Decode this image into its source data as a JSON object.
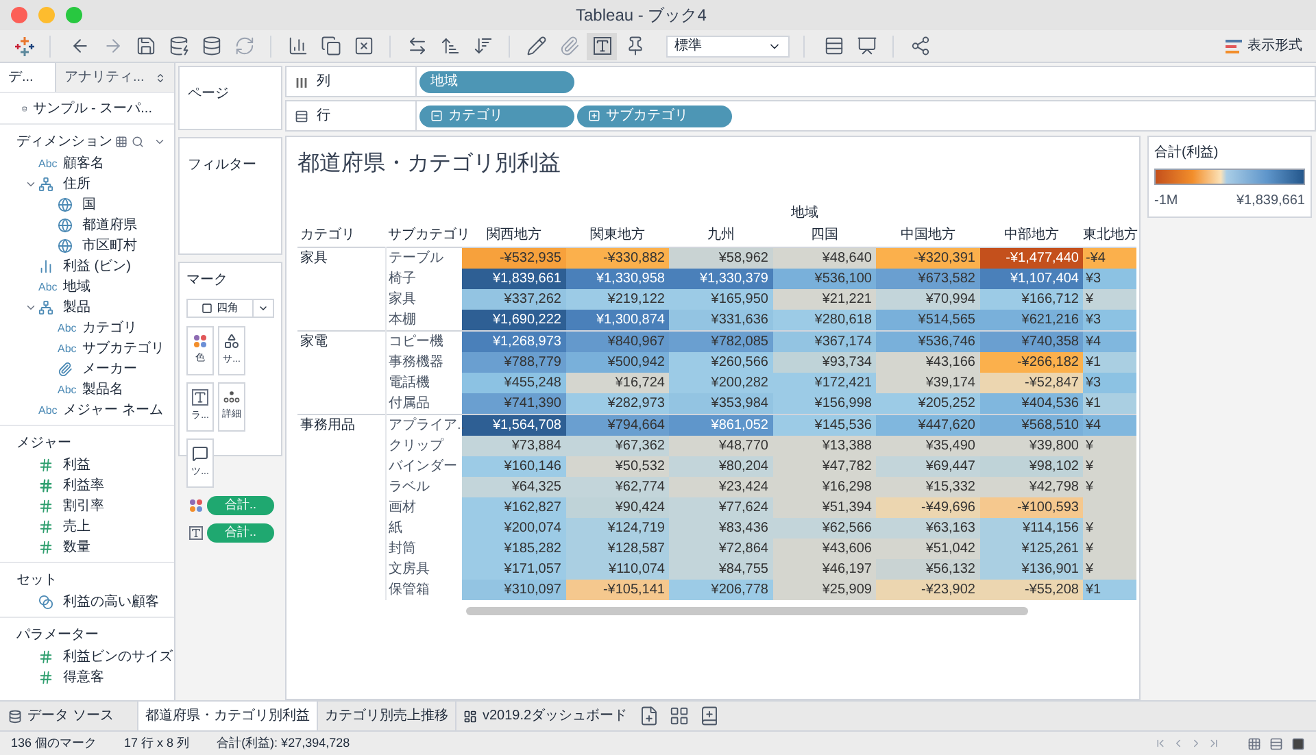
{
  "window": {
    "title": "Tableau - ブック4"
  },
  "toolbar": {
    "dropdown": "標準",
    "show_me": "表示形式"
  },
  "data_pane": {
    "tabs": [
      {
        "label": "デ...",
        "selected": true
      },
      {
        "label": "アナリティ...",
        "selected": false
      }
    ],
    "data_source": "サンプル - スーパ...",
    "dimensions": {
      "title": "ディメンション",
      "items": [
        {
          "kind": "text",
          "badge": "Abc",
          "label": "顧客名"
        },
        {
          "kind": "hierarchy",
          "label": "住所",
          "expanded": true,
          "children": [
            {
              "kind": "geo",
              "label": "国"
            },
            {
              "kind": "geo",
              "label": "都道府県"
            },
            {
              "kind": "geo",
              "label": "市区町村"
            }
          ]
        },
        {
          "kind": "bin",
          "label": "利益 (ビン)"
        },
        {
          "kind": "text",
          "badge": "Abc",
          "label": "地域"
        },
        {
          "kind": "hierarchy",
          "label": "製品",
          "expanded": true,
          "children": [
            {
              "kind": "text",
              "badge": "Abc",
              "label": "カテゴリ"
            },
            {
              "kind": "text",
              "badge": "Abc",
              "label": "サブカテゴリ"
            },
            {
              "kind": "group",
              "label": "メーカー"
            },
            {
              "kind": "text",
              "badge": "Abc",
              "label": "製品名"
            }
          ]
        },
        {
          "kind": "text",
          "badge": "Abc",
          "label": "メジャー ネーム"
        }
      ]
    },
    "measures": {
      "title": "メジャー",
      "items": [
        {
          "kind": "number",
          "label": "利益"
        },
        {
          "kind": "calc",
          "label": "利益率"
        },
        {
          "kind": "number",
          "label": "割引率"
        },
        {
          "kind": "number",
          "label": "売上"
        },
        {
          "kind": "number",
          "label": "数量"
        }
      ]
    },
    "sets": {
      "title": "セット",
      "items": [
        {
          "kind": "set",
          "label": "利益の高い顧客"
        }
      ]
    },
    "parameters": {
      "title": "パラメーター",
      "items": [
        {
          "kind": "number",
          "label": "利益ビンのサイズ"
        },
        {
          "kind": "number",
          "label": "得意客"
        }
      ]
    }
  },
  "pages_shelf": {
    "title": "ページ"
  },
  "filters_shelf": {
    "title": "フィルター"
  },
  "marks_card": {
    "title": "マーク",
    "mark_type": "四角",
    "buttons": [
      {
        "kind": "color",
        "label": "色"
      },
      {
        "kind": "size",
        "label": "サ..."
      },
      {
        "kind": "label",
        "label": "ラ..."
      },
      {
        "kind": "detail",
        "label": "詳細"
      },
      {
        "kind": "tooltip",
        "label": "ツ..."
      }
    ],
    "pills": [
      {
        "kind": "color",
        "label": "合計.."
      },
      {
        "kind": "label",
        "label": "合計.."
      }
    ]
  },
  "columns_shelf": {
    "label": "列",
    "pills": [
      {
        "label": "地域"
      }
    ]
  },
  "rows_shelf": {
    "label": "行",
    "pills": [
      {
        "label": "カテゴリ",
        "expanded": true
      },
      {
        "label": "サブカテゴリ",
        "expanded": false
      }
    ]
  },
  "view": {
    "title": "都道府県・カテゴリ別利益",
    "column_group": "地域",
    "headers": [
      "カテゴリ",
      "サブカテゴリ",
      "関西地方",
      "関東地方",
      "九州",
      "四国",
      "中国地方",
      "中部地方",
      "東北地方"
    ],
    "groups": [
      {
        "category": "家具",
        "rows": [
          {
            "subcategory": "テーブル",
            "cells": [
              {
                "text": "-¥532,935",
                "color": "#f7a13c"
              },
              {
                "text": "-¥330,882",
                "color": "#fbb04c"
              },
              {
                "text": "¥58,962",
                "color": "#c9d3d3"
              },
              {
                "text": "¥48,640",
                "color": "#d5d6cf"
              },
              {
                "text": "-¥320,391",
                "color": "#fbb04c"
              },
              {
                "text": "-¥1,477,440",
                "color": "#c4501c"
              },
              {
                "text": "-¥4",
                "color": "#fbb04c"
              }
            ]
          },
          {
            "subcategory": "椅子",
            "cells": [
              {
                "text": "¥1,839,661",
                "color": "#2e5f94"
              },
              {
                "text": "¥1,330,958",
                "color": "#4a80ba"
              },
              {
                "text": "¥1,330,379",
                "color": "#4a80ba"
              },
              {
                "text": "¥536,100",
                "color": "#79b0da"
              },
              {
                "text": "¥673,582",
                "color": "#6a9fd0"
              },
              {
                "text": "¥1,107,404",
                "color": "#4a80ba"
              },
              {
                "text": "¥3",
                "color": "#8cc2e3"
              }
            ]
          },
          {
            "subcategory": "家具",
            "cells": [
              {
                "text": "¥337,262",
                "color": "#93c4e2"
              },
              {
                "text": "¥219,122",
                "color": "#9ccbe6"
              },
              {
                "text": "¥165,950",
                "color": "#9ccbe6"
              },
              {
                "text": "¥21,221",
                "color": "#d5d6cf"
              },
              {
                "text": "¥70,994",
                "color": "#c3d5da"
              },
              {
                "text": "¥166,712",
                "color": "#9ccbe6"
              },
              {
                "text": "¥",
                "color": "#c3d5da"
              }
            ]
          },
          {
            "subcategory": "本棚",
            "cells": [
              {
                "text": "¥1,690,222",
                "color": "#2e5f94"
              },
              {
                "text": "¥1,300,874",
                "color": "#4a80ba"
              },
              {
                "text": "¥331,636",
                "color": "#93c4e2"
              },
              {
                "text": "¥280,618",
                "color": "#9ccbe6"
              },
              {
                "text": "¥514,565",
                "color": "#79b0da"
              },
              {
                "text": "¥621,216",
                "color": "#79b0da"
              },
              {
                "text": "¥3",
                "color": "#8cc2e3"
              }
            ]
          }
        ]
      },
      {
        "category": "家電",
        "rows": [
          {
            "subcategory": "コピー機",
            "cells": [
              {
                "text": "¥1,268,973",
                "color": "#4a80ba"
              },
              {
                "text": "¥840,967",
                "color": "#6499cc"
              },
              {
                "text": "¥782,085",
                "color": "#6a9fd0"
              },
              {
                "text": "¥367,174",
                "color": "#93c4e2"
              },
              {
                "text": "¥536,746",
                "color": "#79b0da"
              },
              {
                "text": "¥740,358",
                "color": "#6a9fd0"
              },
              {
                "text": "¥4",
                "color": "#80b7de"
              }
            ]
          },
          {
            "subcategory": "事務機器",
            "cells": [
              {
                "text": "¥788,779",
                "color": "#6a9fd0"
              },
              {
                "text": "¥500,942",
                "color": "#79b0da"
              },
              {
                "text": "¥260,566",
                "color": "#9ccbe6"
              },
              {
                "text": "¥93,734",
                "color": "#bfd3d8"
              },
              {
                "text": "¥43,166",
                "color": "#d5d6cf"
              },
              {
                "text": "-¥266,182",
                "color": "#fbb04c"
              },
              {
                "text": "¥1",
                "color": "#aacfe2"
              }
            ]
          },
          {
            "subcategory": "電話機",
            "cells": [
              {
                "text": "¥455,248",
                "color": "#8cc2e3"
              },
              {
                "text": "¥16,724",
                "color": "#d5d6cf"
              },
              {
                "text": "¥200,282",
                "color": "#9ccbe6"
              },
              {
                "text": "¥172,421",
                "color": "#9ccbe6"
              },
              {
                "text": "¥39,174",
                "color": "#d5d6cf"
              },
              {
                "text": "-¥52,847",
                "color": "#ecd6b0"
              },
              {
                "text": "¥3",
                "color": "#8cc2e3"
              }
            ]
          },
          {
            "subcategory": "付属品",
            "cells": [
              {
                "text": "¥741,390",
                "color": "#6a9fd0"
              },
              {
                "text": "¥282,973",
                "color": "#9ccbe6"
              },
              {
                "text": "¥353,984",
                "color": "#93c4e2"
              },
              {
                "text": "¥156,998",
                "color": "#9ccbe6"
              },
              {
                "text": "¥205,252",
                "color": "#9ccbe6"
              },
              {
                "text": "¥404,536",
                "color": "#80b7de"
              },
              {
                "text": "¥1",
                "color": "#aacfe2"
              }
            ]
          }
        ]
      },
      {
        "category": "事務用品",
        "rows": [
          {
            "subcategory": "アプライア..",
            "cells": [
              {
                "text": "¥1,564,708",
                "color": "#2e5f94"
              },
              {
                "text": "¥794,664",
                "color": "#6a9fd0"
              },
              {
                "text": "¥861,052",
                "color": "#5f96cb"
              },
              {
                "text": "¥145,536",
                "color": "#9ccbe6"
              },
              {
                "text": "¥447,620",
                "color": "#80b7de"
              },
              {
                "text": "¥568,510",
                "color": "#79b0da"
              },
              {
                "text": "¥4",
                "color": "#80b7de"
              }
            ]
          },
          {
            "subcategory": "クリップ",
            "cells": [
              {
                "text": "¥73,884",
                "color": "#c3d5da"
              },
              {
                "text": "¥67,362",
                "color": "#c3d5da"
              },
              {
                "text": "¥48,770",
                "color": "#d5d6cf"
              },
              {
                "text": "¥13,388",
                "color": "#d5d6cf"
              },
              {
                "text": "¥35,490",
                "color": "#d5d6cf"
              },
              {
                "text": "¥39,800",
                "color": "#d5d6cf"
              },
              {
                "text": "¥",
                "color": "#d5d6cf"
              }
            ]
          },
          {
            "subcategory": "バインダー",
            "cells": [
              {
                "text": "¥160,146",
                "color": "#9ccbe6"
              },
              {
                "text": "¥50,532",
                "color": "#d5d6cf"
              },
              {
                "text": "¥80,204",
                "color": "#c3d5da"
              },
              {
                "text": "¥47,782",
                "color": "#d5d6cf"
              },
              {
                "text": "¥69,447",
                "color": "#c3d5da"
              },
              {
                "text": "¥98,102",
                "color": "#bfd3d8"
              },
              {
                "text": "¥",
                "color": "#d5d6cf"
              }
            ]
          },
          {
            "subcategory": "ラベル",
            "cells": [
              {
                "text": "¥64,325",
                "color": "#c3d5da"
              },
              {
                "text": "¥62,774",
                "color": "#c3d5da"
              },
              {
                "text": "¥23,424",
                "color": "#d5d6cf"
              },
              {
                "text": "¥16,298",
                "color": "#d5d6cf"
              },
              {
                "text": "¥15,332",
                "color": "#d5d6cf"
              },
              {
                "text": "¥42,798",
                "color": "#d5d6cf"
              },
              {
                "text": "¥",
                "color": "#d5d6cf"
              }
            ]
          },
          {
            "subcategory": "画材",
            "cells": [
              {
                "text": "¥162,827",
                "color": "#9ccbe6"
              },
              {
                "text": "¥90,424",
                "color": "#bfd3d8"
              },
              {
                "text": "¥77,624",
                "color": "#c3d5da"
              },
              {
                "text": "¥51,394",
                "color": "#d5d6cf"
              },
              {
                "text": "-¥49,696",
                "color": "#ecd6b0"
              },
              {
                "text": "-¥100,593",
                "color": "#f5c88e"
              },
              {
                "color": "#d5d6cf"
              }
            ]
          },
          {
            "subcategory": "紙",
            "cells": [
              {
                "text": "¥200,074",
                "color": "#9ccbe6"
              },
              {
                "text": "¥124,719",
                "color": "#aacfe2"
              },
              {
                "text": "¥83,436",
                "color": "#c3d5da"
              },
              {
                "text": "¥62,566",
                "color": "#c3d5da"
              },
              {
                "text": "¥63,163",
                "color": "#c3d5da"
              },
              {
                "text": "¥114,156",
                "color": "#aacfe2"
              },
              {
                "text": "¥",
                "color": "#d5d6cf"
              }
            ]
          },
          {
            "subcategory": "封筒",
            "cells": [
              {
                "text": "¥185,282",
                "color": "#9ccbe6"
              },
              {
                "text": "¥128,587",
                "color": "#aacfe2"
              },
              {
                "text": "¥72,864",
                "color": "#c3d5da"
              },
              {
                "text": "¥43,606",
                "color": "#d5d6cf"
              },
              {
                "text": "¥51,042",
                "color": "#d5d6cf"
              },
              {
                "text": "¥125,261",
                "color": "#aacfe2"
              },
              {
                "text": "¥",
                "color": "#d5d6cf"
              }
            ]
          },
          {
            "subcategory": "文房具",
            "cells": [
              {
                "text": "¥171,057",
                "color": "#9ccbe6"
              },
              {
                "text": "¥110,074",
                "color": "#aacfe2"
              },
              {
                "text": "¥84,755",
                "color": "#c3d5da"
              },
              {
                "text": "¥46,197",
                "color": "#d5d6cf"
              },
              {
                "text": "¥56,132",
                "color": "#c9d3d3"
              },
              {
                "text": "¥136,901",
                "color": "#aacfe2"
              },
              {
                "text": "¥",
                "color": "#d5d6cf"
              }
            ]
          },
          {
            "subcategory": "保管箱",
            "cells": [
              {
                "text": "¥310,097",
                "color": "#93c4e2"
              },
              {
                "text": "-¥105,141",
                "color": "#f5c88e"
              },
              {
                "text": "¥206,778",
                "color": "#9ccbe6"
              },
              {
                "text": "¥25,909",
                "color": "#d5d6cf"
              },
              {
                "text": "-¥23,902",
                "color": "#ecd6b0"
              },
              {
                "text": "-¥55,208",
                "color": "#ecd6b0"
              },
              {
                "text": "¥1",
                "color": "#9ccbe6"
              }
            ]
          }
        ]
      }
    ]
  },
  "legend": {
    "title": "合計(利益)",
    "min": "-1M",
    "max": "¥1,839,661"
  },
  "sheet_tabs": {
    "data_source": "データ ソース",
    "tabs": [
      {
        "kind": "sheet",
        "label": "都道府県・カテゴリ別利益",
        "selected": true
      },
      {
        "kind": "sheet",
        "label": "カテゴリ別売上推移",
        "selected": false
      },
      {
        "kind": "dashboard",
        "label": "v2019.2ダッシュボード",
        "selected": false
      }
    ]
  },
  "status_bar": {
    "marks": "136 個のマーク",
    "size": "17 行 x 8 列",
    "sum": "合計(利益): ¥27,394,728"
  }
}
